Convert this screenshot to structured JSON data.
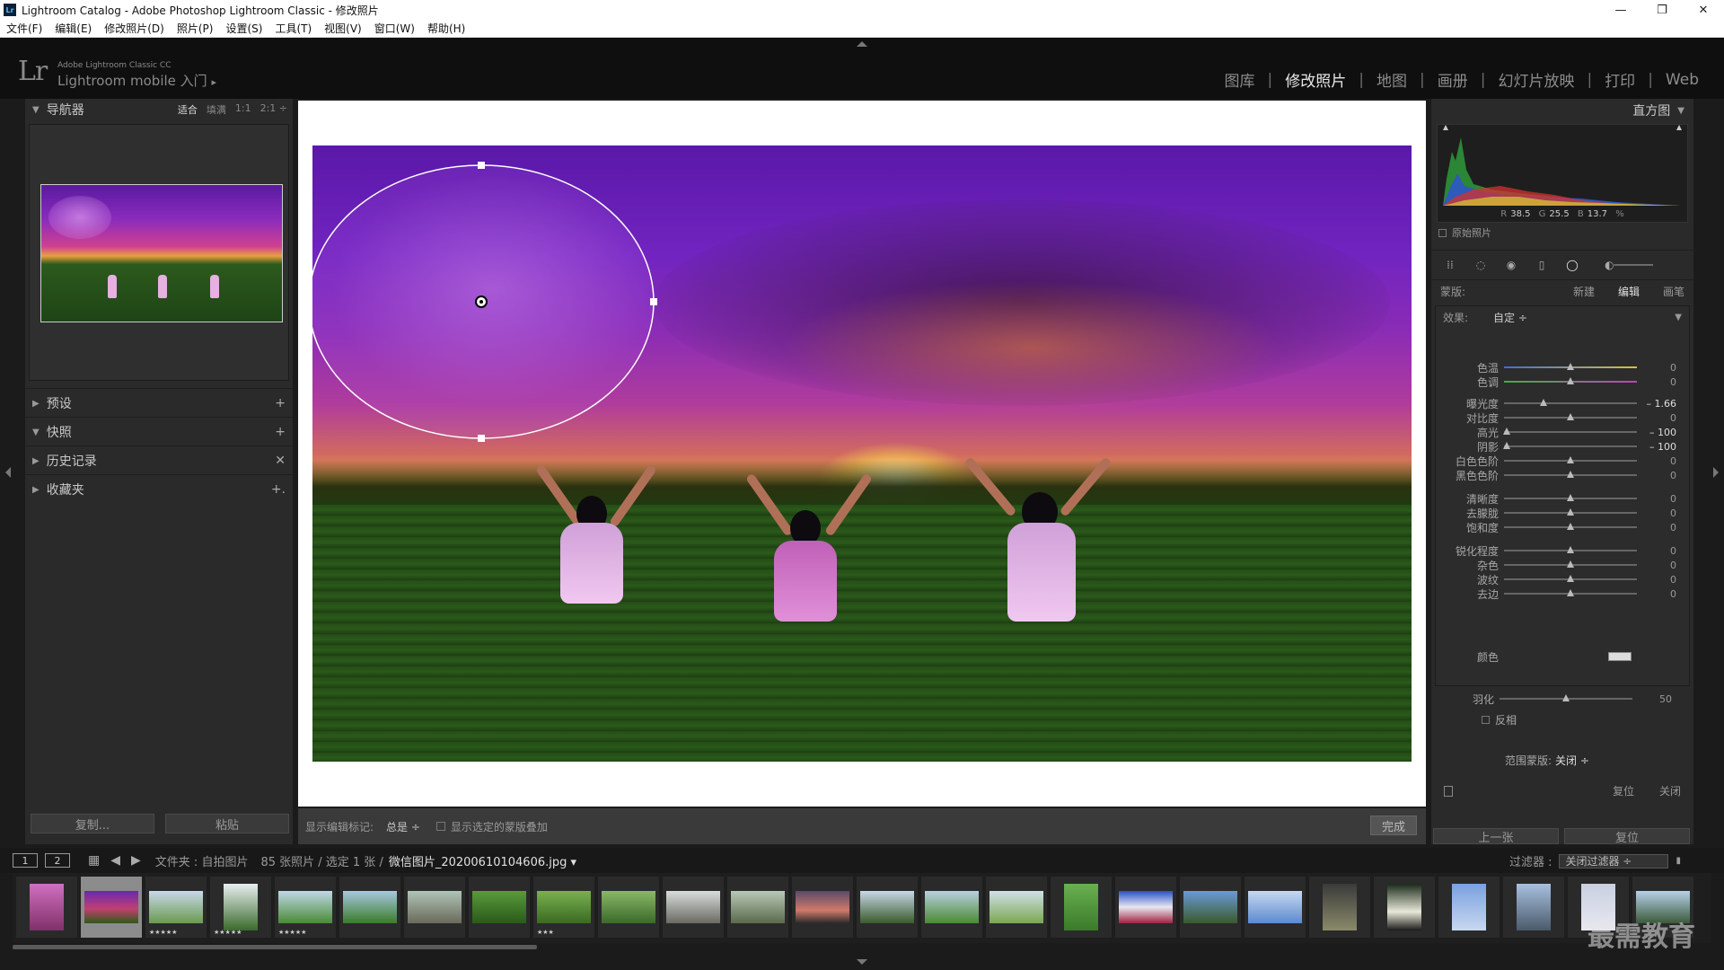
{
  "window": {
    "title": "Lightroom Catalog - Adobe Photoshop Lightroom Classic - 修改照片",
    "controls": {
      "minimize": "—",
      "maximize": "❐",
      "close": "✕"
    }
  },
  "menu": [
    "文件(F)",
    "编辑(E)",
    "修改照片(D)",
    "照片(P)",
    "设置(S)",
    "工具(T)",
    "视图(V)",
    "窗口(W)",
    "帮助(H)"
  ],
  "identity": {
    "logo": "Lr",
    "line1": "Adobe Lightroom Classic CC",
    "line2": "Lightroom mobile 入门",
    "arrow": "▸"
  },
  "modules": [
    {
      "label": "图库",
      "active": false
    },
    {
      "label": "修改照片",
      "active": true
    },
    {
      "label": "地图",
      "active": false
    },
    {
      "label": "画册",
      "active": false
    },
    {
      "label": "幻灯片放映",
      "active": false
    },
    {
      "label": "打印",
      "active": false
    },
    {
      "label": "Web",
      "active": false
    }
  ],
  "left_panel": {
    "navigator": {
      "title": "导航器",
      "zoom": [
        "适合",
        "填满",
        "1:1",
        "2:1 ÷"
      ],
      "zoom_active": "适合"
    },
    "sections": [
      {
        "title": "预设",
        "tri": "▶",
        "icon": "+"
      },
      {
        "title": "快照",
        "tri": "▼",
        "icon": "+"
      },
      {
        "title": "历史记录",
        "tri": "▶",
        "icon": "✕"
      },
      {
        "title": "收藏夹",
        "tri": "▶",
        "icon": "+."
      }
    ],
    "buttons": {
      "copy": "复制...",
      "paste": "粘贴"
    }
  },
  "edit_toolbar": {
    "show_label": "显示编辑标记:",
    "show_value": "总是 ÷",
    "overlay_label": "显示选定的蒙版叠加",
    "done": "完成"
  },
  "right_panel": {
    "histogram_title": "直方图",
    "rgb": {
      "r_label": "R",
      "r": "38.5",
      "g_label": "G",
      "g": "25.5",
      "b_label": "B",
      "b": "13.7",
      "unit": "%"
    },
    "original_photo": "原始照片",
    "mask": {
      "label": "蒙版:",
      "new": "新建",
      "edit": "编辑",
      "brush": "画笔"
    },
    "effect": {
      "label": "效果:",
      "value": "自定 ÷"
    },
    "sliders": [
      {
        "label": "色温",
        "value": "0",
        "pos": 0.5
      },
      {
        "label": "色调",
        "value": "0",
        "pos": 0.5
      },
      {
        "label": "曝光度",
        "value": "– 1.66",
        "pos": 0.3
      },
      {
        "label": "对比度",
        "value": "0",
        "pos": 0.5
      },
      {
        "label": "高光",
        "value": "– 100",
        "pos": 0.02
      },
      {
        "label": "阴影",
        "value": "– 100",
        "pos": 0.02
      },
      {
        "label": "白色色阶",
        "value": "0",
        "pos": 0.5
      },
      {
        "label": "黑色色阶",
        "value": "0",
        "pos": 0.5
      },
      {
        "label": "清晰度",
        "value": "0",
        "pos": 0.5
      },
      {
        "label": "去朦胧",
        "value": "0",
        "pos": 0.5
      },
      {
        "label": "饱和度",
        "value": "0",
        "pos": 0.5
      },
      {
        "label": "锐化程度",
        "value": "0",
        "pos": 0.5
      },
      {
        "label": "杂色",
        "value": "0",
        "pos": 0.5
      },
      {
        "label": "波纹",
        "value": "0",
        "pos": 0.5
      },
      {
        "label": "去边",
        "value": "0",
        "pos": 0.5
      }
    ],
    "color_label": "颜色",
    "feather": {
      "label": "羽化",
      "value": "50",
      "pos": 0.5
    },
    "invert": "反相",
    "range_mask": {
      "label": "范围蒙版:",
      "value": "关闭 ÷"
    },
    "reset": "复位",
    "close": "关闭",
    "prev_button": "上一张",
    "reset_button": "复位"
  },
  "filmbar": {
    "monitor1": "1",
    "monitor2": "2",
    "path": "文件夹 : 自拍图片",
    "count": "85 张照片 / 选定 1 张 /",
    "filename": "微信图片_20200610104606.jpg ▾",
    "filter_label": "过滤器 :",
    "filter_value": "关闭过滤器 ÷"
  },
  "filmstrip_stars": [
    "",
    "",
    "★★★★★",
    "★★★★★",
    "★★★★★",
    "",
    "",
    "",
    "★★★",
    "",
    "",
    "",
    "",
    "",
    "",
    "",
    "",
    "",
    "",
    "",
    "",
    "",
    "",
    "",
    "",
    ""
  ],
  "watermark": "最需教育"
}
